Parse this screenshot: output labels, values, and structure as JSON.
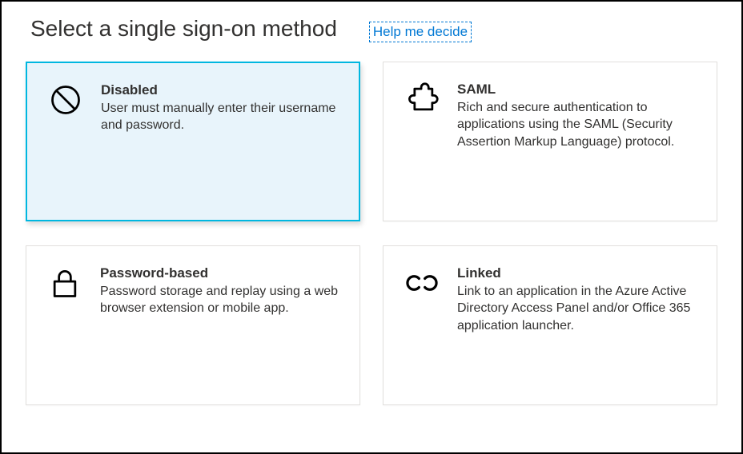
{
  "header": {
    "title": "Select a single sign-on method",
    "help_link": "Help me decide"
  },
  "cards": {
    "disabled": {
      "title": "Disabled",
      "desc": "User must manually enter their username and password."
    },
    "saml": {
      "title": "SAML",
      "desc": "Rich and secure authentication to applications using the SAML (Security Assertion Markup Language) protocol."
    },
    "password": {
      "title": "Password-based",
      "desc": "Password storage and replay using a web browser extension or mobile app."
    },
    "linked": {
      "title": "Linked",
      "desc": "Link to an application in the Azure Active Directory Access Panel and/or Office 365 application launcher."
    }
  }
}
